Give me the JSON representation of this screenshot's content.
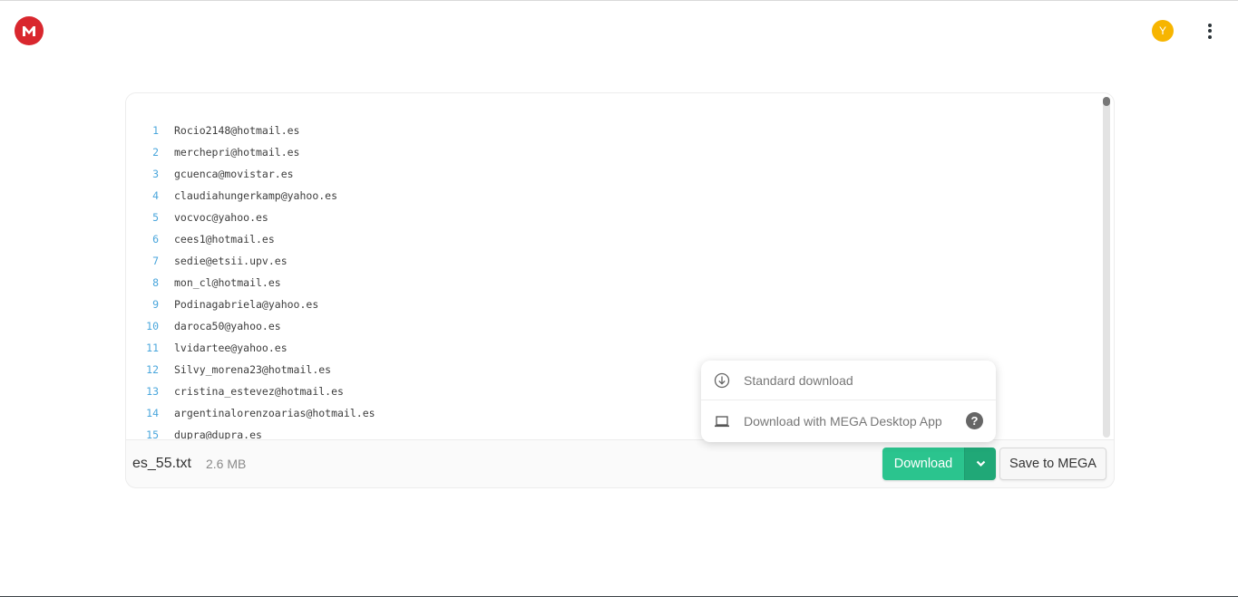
{
  "header": {
    "logo_icon": "mega-logo-icon",
    "avatar_initial": "Y",
    "menu_icon": "more-vertical-icon"
  },
  "viewer": {
    "lines": [
      {
        "num": "1",
        "text": "Rocio2148@hotmail.es"
      },
      {
        "num": "2",
        "text": "merchepri@hotmail.es"
      },
      {
        "num": "3",
        "text": "gcuenca@movistar.es"
      },
      {
        "num": "4",
        "text": "claudiahungerkamp@yahoo.es"
      },
      {
        "num": "5",
        "text": "vocvoc@yahoo.es"
      },
      {
        "num": "6",
        "text": "cees1@hotmail.es"
      },
      {
        "num": "7",
        "text": "sedie@etsii.upv.es"
      },
      {
        "num": "8",
        "text": "mon_cl@hotmail.es"
      },
      {
        "num": "9",
        "text": "Podinagabriela@yahoo.es"
      },
      {
        "num": "10",
        "text": "daroca50@yahoo.es"
      },
      {
        "num": "11",
        "text": "lvidartee@yahoo.es"
      },
      {
        "num": "12",
        "text": "Silvy_morena23@hotmail.es"
      },
      {
        "num": "13",
        "text": "cristina_estevez@hotmail.es"
      },
      {
        "num": "14",
        "text": "argentinalorenzoarias@hotmail.es"
      },
      {
        "num": "15",
        "text": "dupra@dupra.es"
      }
    ]
  },
  "file": {
    "name": "es_55.txt",
    "size": "2.6 MB"
  },
  "actions": {
    "download_label": "Download",
    "save_label": "Save to MEGA"
  },
  "dropdown": {
    "items": [
      {
        "label": "Standard download",
        "icon": "download-circle-icon"
      },
      {
        "label": "Download with MEGA Desktop App",
        "icon": "laptop-icon"
      }
    ],
    "help_glyph": "?"
  },
  "colors": {
    "brand_red": "#d9272e",
    "download_green": "#2bc48e",
    "avatar_yellow": "#f7b500",
    "line_number_blue": "#4aa6dc"
  }
}
